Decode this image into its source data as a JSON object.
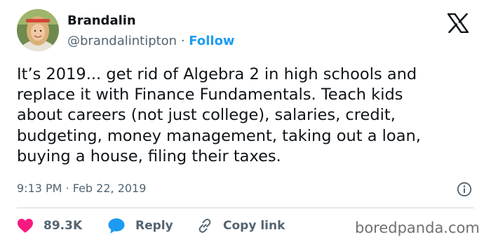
{
  "author": {
    "name": "Brandalin",
    "handle": "@brandalintipton",
    "separator": "·",
    "follow_label": "Follow"
  },
  "tweet": {
    "text": "It’s 2019... get rid of Algebra 2 in high schools and\nreplace it with Finance Fundamentals. Teach kids\nabout careers (not just college), salaries, credit,\nbudgeting, money management, taking out a loan,\nbuying a house, filing their taxes.",
    "time": "9:13 PM",
    "separator": "·",
    "date": "Feb 22, 2019"
  },
  "actions": {
    "likes": "89.3K",
    "reply_label": "Reply",
    "copy_link_label": "Copy link"
  },
  "watermark": "boredpanda.com",
  "icons": [
    "x-logo-icon",
    "info-icon",
    "heart-icon",
    "reply-bubble-icon",
    "link-icon"
  ],
  "colors": {
    "text": "#0f1419",
    "secondary": "#536471",
    "follow": "#1d9bf0",
    "like": "#f91880",
    "reply": "#1d9bf0",
    "divider": "#cfd9de"
  }
}
